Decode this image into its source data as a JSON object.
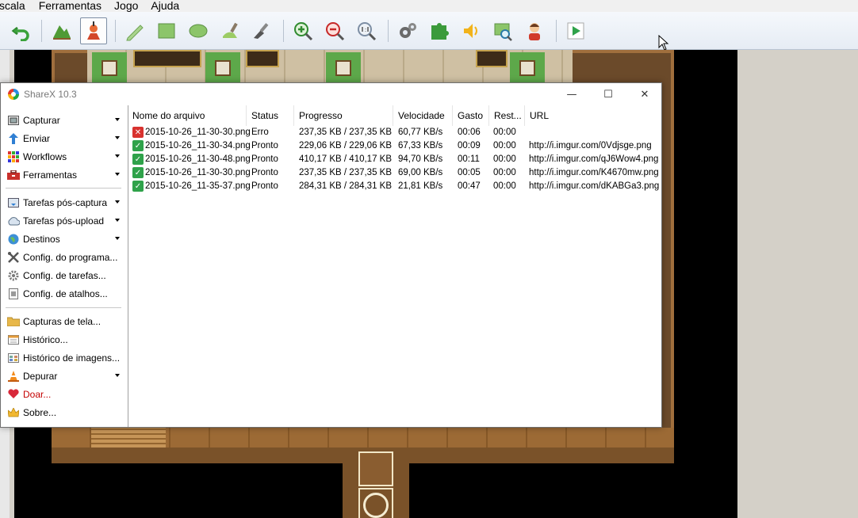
{
  "editor": {
    "menu": [
      "scala",
      "Ferramentas",
      "Jogo",
      "Ajuda"
    ],
    "toolbar_icons": [
      "undo-icon",
      "map-layer-icon",
      "event-layer-icon",
      "pencil-icon",
      "rectangle-icon",
      "ellipse-icon",
      "fill-icon",
      "shadow-pen-icon",
      "zoom-in-icon",
      "zoom-out-icon",
      "zoom-actual-icon",
      "database-gear-icon",
      "plugin-icon",
      "sound-icon",
      "resource-manager-icon",
      "character-generator-icon",
      "playtest-icon"
    ]
  },
  "sharex": {
    "title": "ShareX 10.3",
    "window_controls": {
      "minimize": "—",
      "maximize": "☐",
      "close": "✕"
    },
    "sidebar_group1": [
      {
        "label": "Capturar",
        "icon": "capture-icon",
        "arrow": true
      },
      {
        "label": "Enviar",
        "icon": "upload-arrow-icon",
        "arrow": true
      },
      {
        "label": "Workflows",
        "icon": "workflows-grid-icon",
        "arrow": true
      },
      {
        "label": "Ferramentas",
        "icon": "toolbox-icon",
        "arrow": true
      }
    ],
    "sidebar_group2": [
      {
        "label": "Tarefas pós-captura",
        "icon": "after-capture-icon",
        "arrow": true
      },
      {
        "label": "Tarefas pós-upload",
        "icon": "cloud-upload-icon",
        "arrow": true
      },
      {
        "label": "Destinos",
        "icon": "globe-icon",
        "arrow": true
      },
      {
        "label": "Config. do programa...",
        "icon": "wrench-icon",
        "arrow": false
      },
      {
        "label": "Config. de tarefas...",
        "icon": "gear-icon",
        "arrow": false
      },
      {
        "label": "Config. de atalhos...",
        "icon": "keyboard-icon",
        "arrow": false
      }
    ],
    "sidebar_group3": [
      {
        "label": "Capturas de tela...",
        "icon": "folder-icon",
        "arrow": false
      },
      {
        "label": "Histórico...",
        "icon": "history-icon",
        "arrow": false
      },
      {
        "label": "Histórico de imagens...",
        "icon": "image-history-icon",
        "arrow": false
      },
      {
        "label": "Depurar",
        "icon": "traffic-cone-icon",
        "arrow": true
      },
      {
        "label": "Doar...",
        "icon": "heart-icon",
        "arrow": false,
        "red": true
      },
      {
        "label": "Sobre...",
        "icon": "crown-icon",
        "arrow": false
      }
    ],
    "columns": [
      "Nome do arquivo",
      "Status",
      "Progresso",
      "Velocidade",
      "Gasto",
      "Rest...",
      "URL"
    ],
    "rows": [
      {
        "status_icon": "error",
        "file": "2015-10-26_11-30-30.png",
        "status": "Erro",
        "progress": "237,35 KB / 237,35 KB",
        "speed": "60,77 KB/s",
        "elapsed": "00:06",
        "remaining": "00:00",
        "url": ""
      },
      {
        "status_icon": "ok",
        "file": "2015-10-26_11-30-34.png",
        "status": "Pronto",
        "progress": "229,06 KB / 229,06 KB",
        "speed": "67,33 KB/s",
        "elapsed": "00:09",
        "remaining": "00:00",
        "url": "http://i.imgur.com/0Vdjsge.png"
      },
      {
        "status_icon": "ok",
        "file": "2015-10-26_11-30-48.png",
        "status": "Pronto",
        "progress": "410,17 KB / 410,17 KB",
        "speed": "94,70 KB/s",
        "elapsed": "00:11",
        "remaining": "00:00",
        "url": "http://i.imgur.com/qJ6Wow4.png"
      },
      {
        "status_icon": "ok",
        "file": "2015-10-26_11-30-30.png",
        "status": "Pronto",
        "progress": "237,35 KB / 237,35 KB",
        "speed": "69,00 KB/s",
        "elapsed": "00:05",
        "remaining": "00:00",
        "url": "http://i.imgur.com/K4670mw.png"
      },
      {
        "status_icon": "ok",
        "file": "2015-10-26_11-35-37.png",
        "status": "Pronto",
        "progress": "284,31 KB / 284,31 KB",
        "speed": "21,81 KB/s",
        "elapsed": "00:47",
        "remaining": "00:00",
        "url": "http://i.imgur.com/dKABGa3.png"
      }
    ]
  }
}
